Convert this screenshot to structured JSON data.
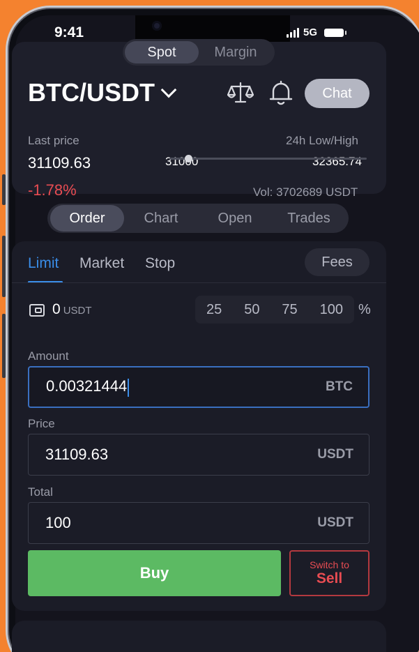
{
  "status": {
    "time": "9:41",
    "network": "5G"
  },
  "market_toggle": {
    "spot": "Spot",
    "margin": "Margin"
  },
  "pair": {
    "name": "BTC/USDT",
    "chat_label": "Chat"
  },
  "ticker": {
    "last_price_label": "Last price",
    "last_price": "31109.63",
    "change": "-1.78%",
    "range_label": "24h Low/High",
    "low": "31000",
    "high": "32365.74",
    "range_position": 0.08,
    "volume": "Vol: 3702689 USDT"
  },
  "main_tabs": [
    "Order",
    "Chart",
    "Open",
    "Trades"
  ],
  "order_tabs": {
    "limit": "Limit",
    "market": "Market",
    "stop": "Stop",
    "fees": "Fees"
  },
  "balance": {
    "value": "0",
    "unit": "USDT"
  },
  "percent_options": [
    "25",
    "50",
    "75",
    "100"
  ],
  "percent_sign": "%",
  "form": {
    "amount_label": "Amount",
    "amount_value": "0.00321444",
    "amount_unit": "BTC",
    "price_label": "Price",
    "price_value": "31109.63",
    "price_unit": "USDT",
    "total_label": "Total",
    "total_value": "100",
    "total_unit": "USDT"
  },
  "actions": {
    "buy": "Buy",
    "switch_small": "Switch to",
    "switch_big": "Sell"
  },
  "colors": {
    "accent": "#3a8de8",
    "buy": "#5cba63",
    "sell": "#e84c52",
    "negative": "#e84c52",
    "background": "#f4822f"
  }
}
